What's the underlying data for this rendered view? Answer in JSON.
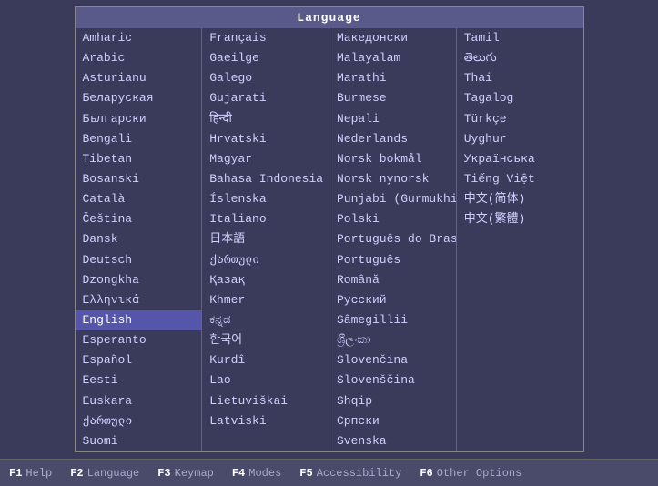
{
  "dialog": {
    "title": "Language"
  },
  "columns": [
    {
      "items": [
        "Amharic",
        "Arabic",
        "Asturianu",
        "Беларуская",
        "Български",
        "Bengali",
        "Tibetan",
        "Bosanski",
        "Català",
        "Čeština",
        "Dansk",
        "Deutsch",
        "Dzongkha",
        "Ελληνικά",
        "English",
        "Esperanto",
        "Español",
        "Eesti",
        "Euskara",
        "ქართული",
        "Suomi"
      ],
      "selected": "English"
    },
    {
      "items": [
        "Français",
        "Gaeilge",
        "Galego",
        "Gujarati",
        "हिन्दी",
        "Hrvatski",
        "Magyar",
        "Bahasa Indonesia",
        "Íslenska",
        "Italiano",
        "日本語",
        "ქართული",
        "Қазақ",
        "Khmer",
        "ಕನ್ನಡ",
        "한국어",
        "Kurdî",
        "Lao",
        "Lietuviškai",
        "Latviski"
      ]
    },
    {
      "items": [
        "Македонски",
        "Malayalam",
        "Marathi",
        "Burmese",
        "Nepali",
        "Nederlands",
        "Norsk bokmål",
        "Norsk nynorsk",
        "Punjabi (Gurmukhi)",
        "Polski",
        "Português do Brasil",
        "Português",
        "Română",
        "Русский",
        "Sâmegillii",
        "ශ්‍රීලංකා",
        "Slovenčina",
        "Slovenščina",
        "Shqip",
        "Српски",
        "Svenska"
      ]
    },
    {
      "items": [
        "Tamil",
        "తెలుగు",
        "Thai",
        "Tagalog",
        "Türkçe",
        "Uyghur",
        "Українська",
        "Tiếng Việt",
        "中文(简体)",
        "中文(繁體)"
      ]
    }
  ],
  "statusbar": [
    {
      "key": "F1",
      "label": "Help"
    },
    {
      "key": "F2",
      "label": "Language"
    },
    {
      "key": "F3",
      "label": "Keymap"
    },
    {
      "key": "F4",
      "label": "Modes"
    },
    {
      "key": "F5",
      "label": "Accessibility"
    },
    {
      "key": "F6",
      "label": "Other Options"
    }
  ]
}
